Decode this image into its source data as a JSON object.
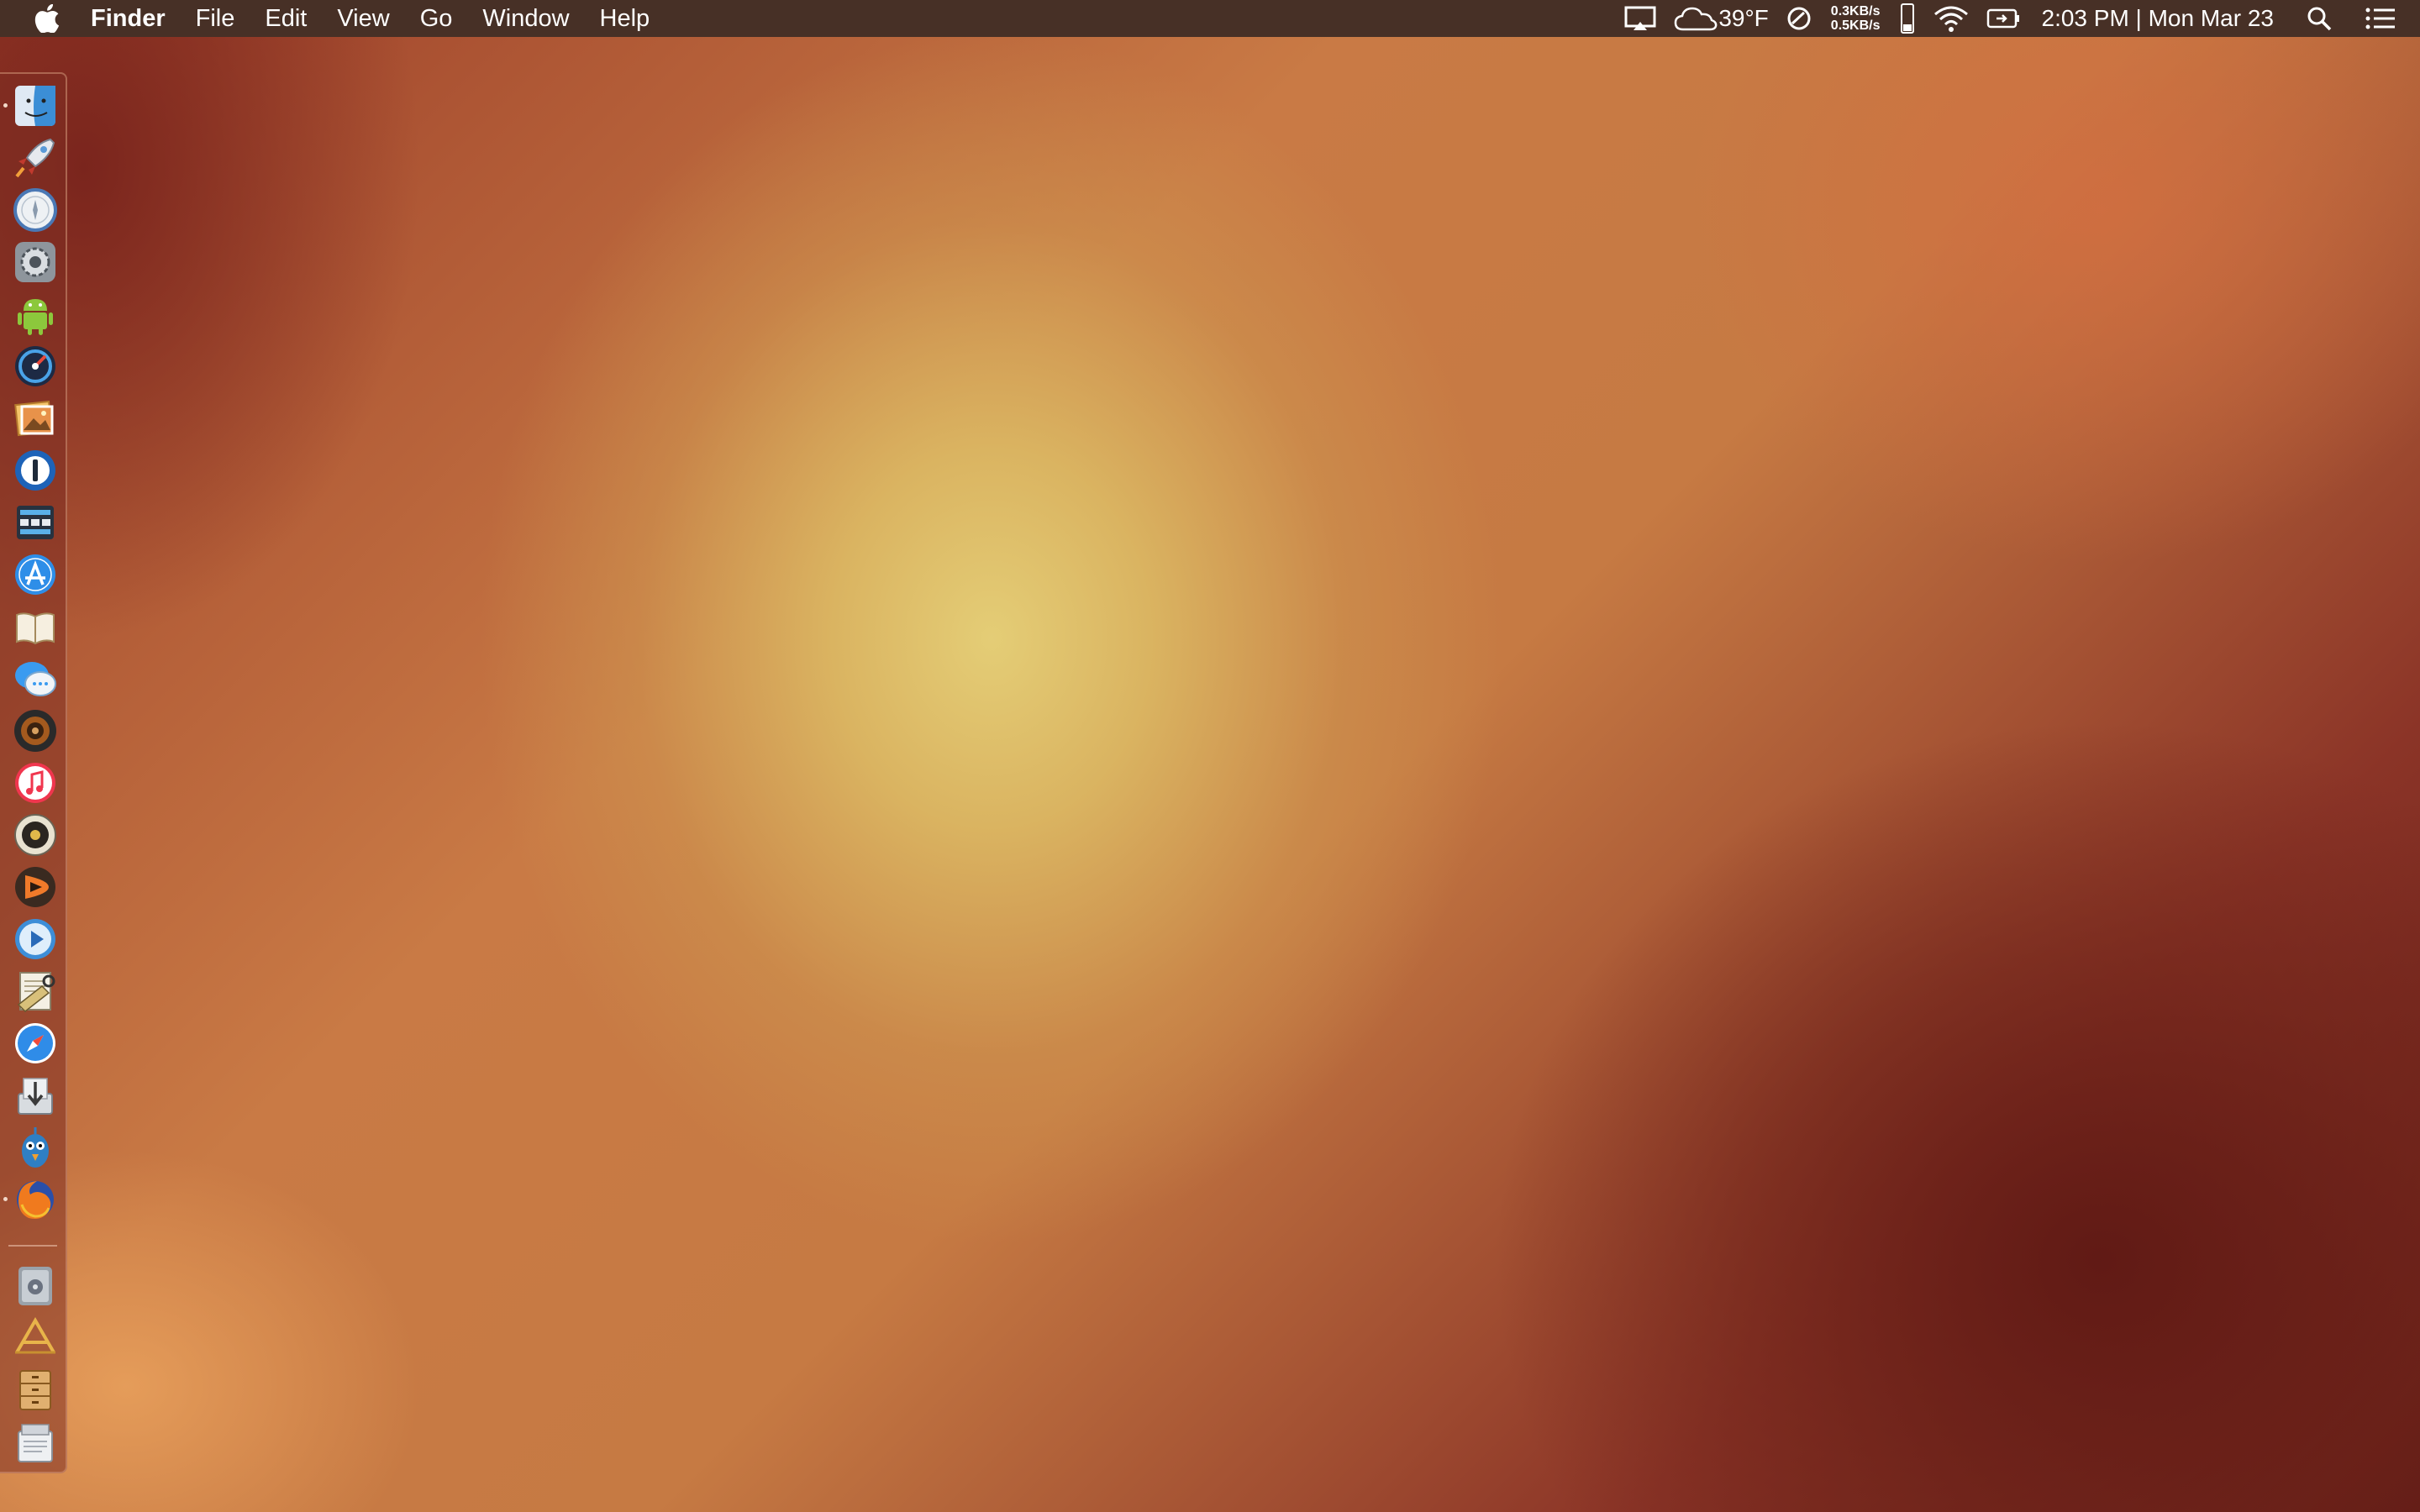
{
  "menubar": {
    "app_name": "Finder",
    "menus": [
      "File",
      "Edit",
      "View",
      "Go",
      "Window",
      "Help"
    ],
    "weather": "39°F",
    "net_up": "0.3KB/s",
    "net_down": "0.5KB/s",
    "clock": "2:03 PM | Mon Mar 23"
  },
  "dock": {
    "items": [
      {
        "name": "finder-icon",
        "running": true
      },
      {
        "name": "launchpad-icon",
        "running": false
      },
      {
        "name": "safari-compass-icon",
        "running": false
      },
      {
        "name": "system-preferences-icon",
        "running": false
      },
      {
        "name": "android-icon",
        "running": false
      },
      {
        "name": "istat-gauge-icon",
        "running": false
      },
      {
        "name": "preview-photos-icon",
        "running": false
      },
      {
        "name": "onepassword-icon",
        "running": false
      },
      {
        "name": "toolbar-app-icon",
        "running": false
      },
      {
        "name": "app-store-icon",
        "running": false
      },
      {
        "name": "books-icon",
        "running": false
      },
      {
        "name": "messages-icon",
        "running": false
      },
      {
        "name": "audio-speaker-icon",
        "running": false
      },
      {
        "name": "itunes-icon",
        "running": false
      },
      {
        "name": "vinyl-player-icon",
        "running": false
      },
      {
        "name": "infuse-play-icon",
        "running": false
      },
      {
        "name": "quicktime-icon",
        "running": false
      },
      {
        "name": "text-editor-icon",
        "running": false
      },
      {
        "name": "safari-icon",
        "running": false
      },
      {
        "name": "downloads-installer-icon",
        "running": false
      },
      {
        "name": "tweetbot-icon",
        "running": false
      },
      {
        "name": "firefox-icon",
        "running": true
      },
      {
        "name": "disk-utility-icon",
        "running": false
      },
      {
        "name": "applications-folder-icon",
        "running": false
      },
      {
        "name": "documents-cabinet-icon",
        "running": false
      },
      {
        "name": "downloads-stack-icon",
        "running": false
      }
    ]
  },
  "colors": {
    "menubar_bg": "#473026",
    "wallpaper_center": "#e3cb74",
    "wallpaper_edge": "#5e1a16"
  }
}
